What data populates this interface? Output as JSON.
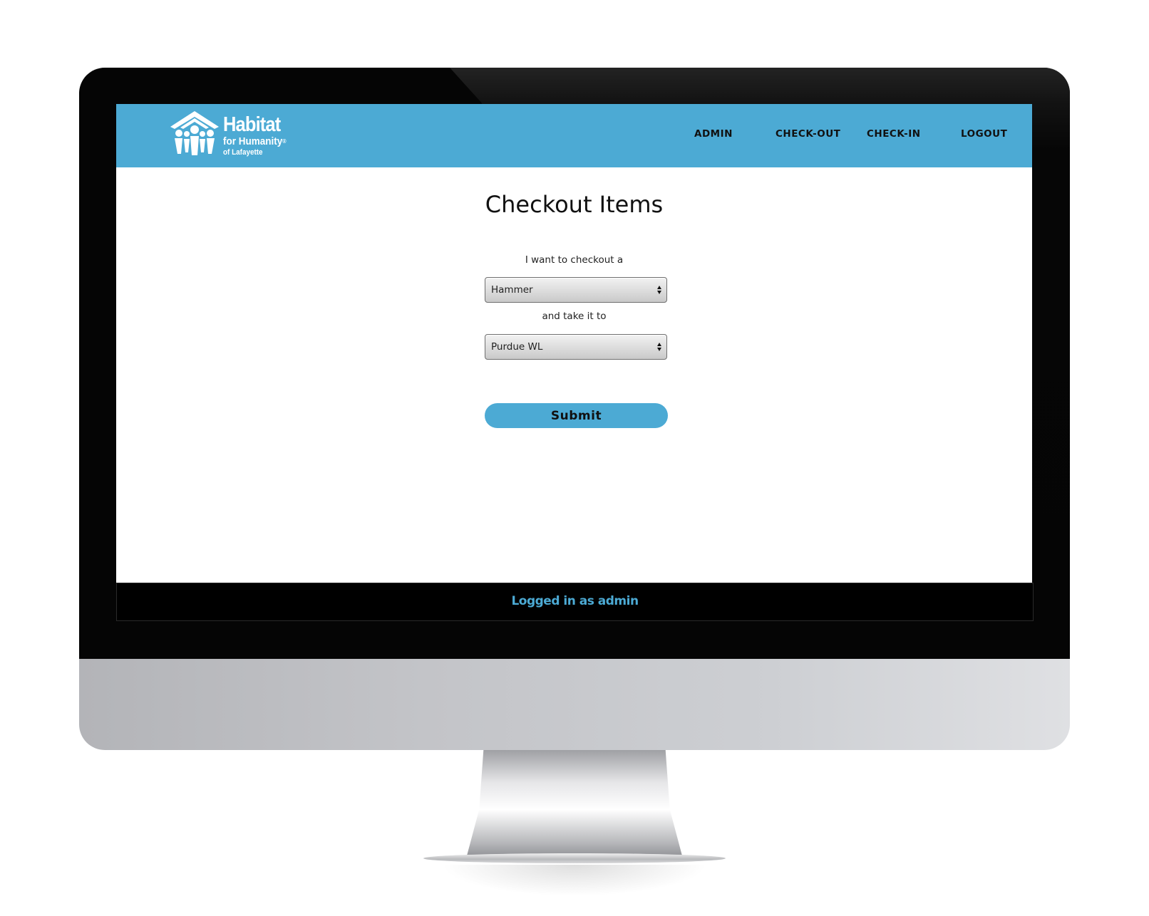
{
  "header": {
    "logo": {
      "title": "Habitat",
      "subtitle": "for Humanity",
      "registered": "®",
      "location": "of Lafayette"
    },
    "nav": [
      {
        "label": "ADMIN"
      },
      {
        "label": "CHECK-OUT"
      },
      {
        "label": "CHECK-IN"
      },
      {
        "label": "LOGOUT"
      }
    ]
  },
  "main": {
    "title": "Checkout Items",
    "item_prompt": "I want to checkout a",
    "item_select": {
      "value": "Hammer"
    },
    "location_prompt": "and take it to",
    "location_select": {
      "value": "Purdue WL"
    },
    "submit_label": "Submit"
  },
  "footer": {
    "status": "Logged in as admin"
  },
  "colors": {
    "brand_blue": "#4caad4",
    "header_text": "#111111",
    "footer_bg": "#000000"
  },
  "icons": {
    "logo": "habitat-house-people-icon",
    "select_arrows": "select-up-down-arrows-icon"
  }
}
